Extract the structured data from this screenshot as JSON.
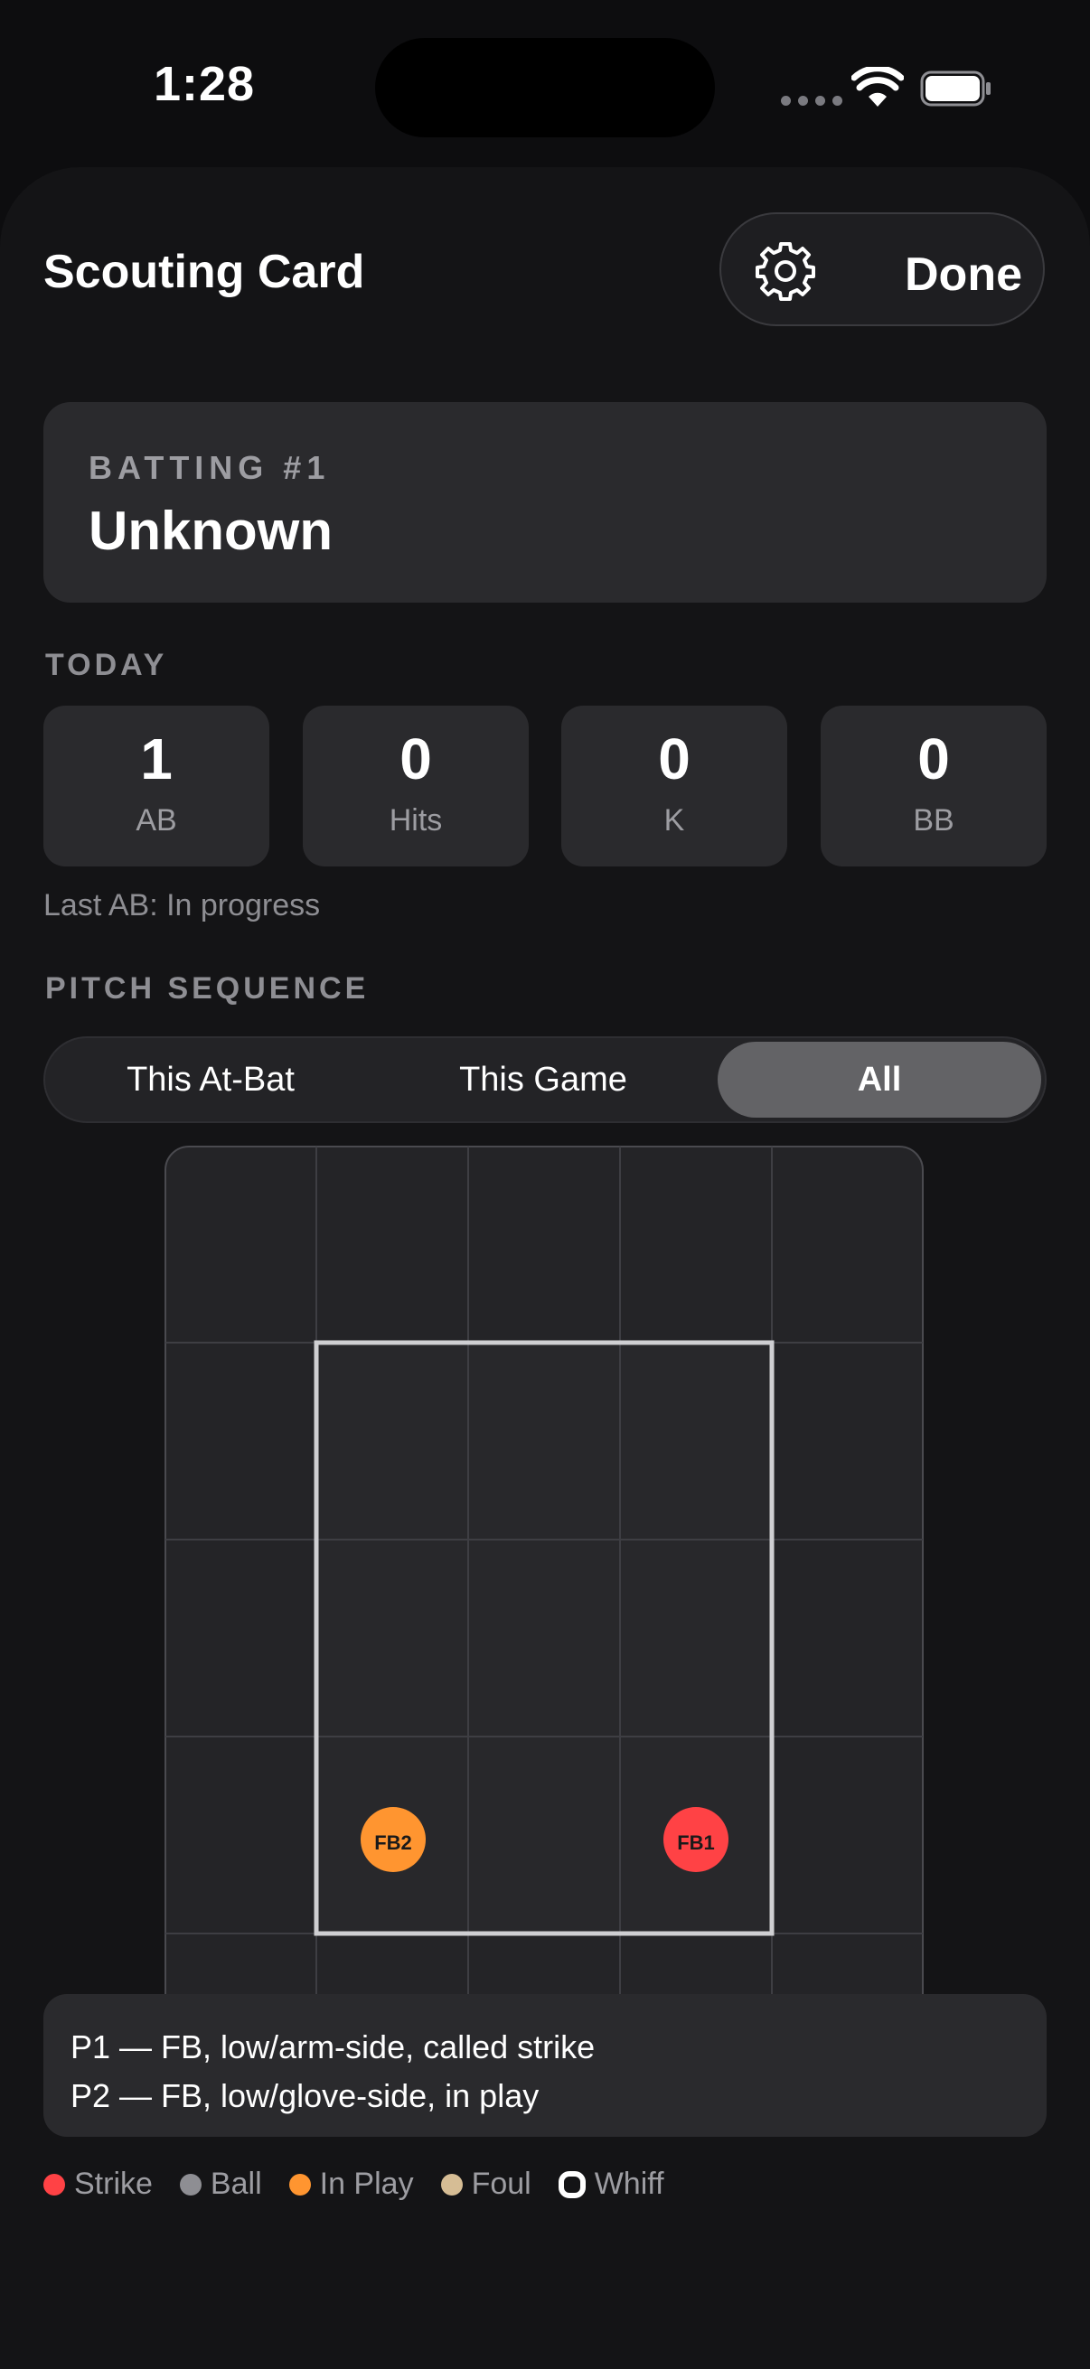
{
  "status": {
    "time": "1:28"
  },
  "header": {
    "title": "Scouting Card",
    "done_label": "Done",
    "settings_icon": "gear-icon"
  },
  "batter": {
    "batting_label": "BATTING #1",
    "name": "Unknown"
  },
  "today": {
    "label": "TODAY",
    "stats": [
      {
        "value": "1",
        "label": "AB"
      },
      {
        "value": "0",
        "label": "Hits"
      },
      {
        "value": "0",
        "label": "K"
      },
      {
        "value": "0",
        "label": "BB"
      }
    ],
    "last_ab": "Last AB: In progress"
  },
  "pitch_sequence": {
    "label": "PITCH SEQUENCE",
    "tabs": [
      {
        "label": "This At-Bat",
        "active": false
      },
      {
        "label": "This Game",
        "active": false
      },
      {
        "label": "All",
        "active": true
      }
    ],
    "pitches": [
      {
        "label": "FB2",
        "result": "in play",
        "color": "#ff9530"
      },
      {
        "label": "FB1",
        "result": "called strike",
        "color": "#ff4245"
      }
    ],
    "notes": [
      "P1 — FB, low/arm-side, called strike",
      "P2 — FB, low/glove-side, in play"
    ]
  },
  "legend": [
    {
      "label": "Strike",
      "color": "#ff4245"
    },
    {
      "label": "Ball",
      "color": "#8e8e93"
    },
    {
      "label": "In Play",
      "color": "#ff9530"
    },
    {
      "label": "Foul",
      "color": "#d6bd95"
    },
    {
      "label": "Whiff",
      "color": "#ffffff",
      "ring": true
    }
  ]
}
